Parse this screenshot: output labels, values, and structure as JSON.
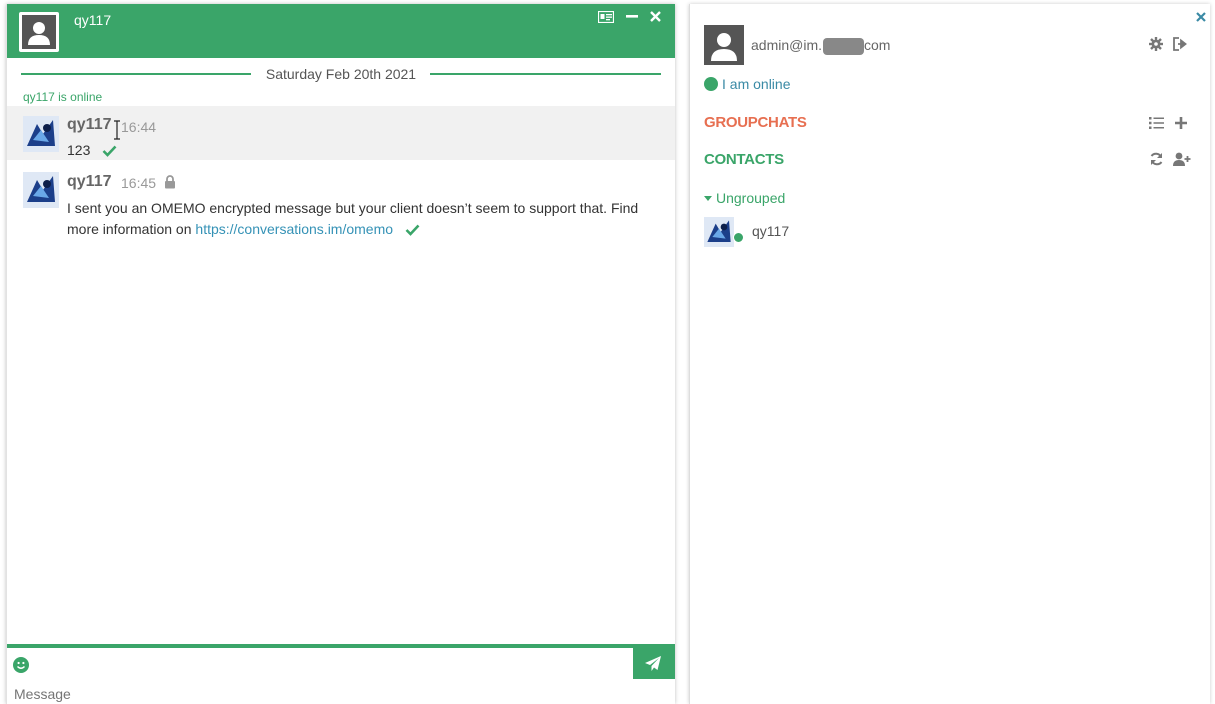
{
  "chat": {
    "title": "qy117",
    "date_separator": "Saturday Feb 20th 2021",
    "status": "qy117 is online",
    "messages": [
      {
        "sender": "qy117",
        "time": "16:44",
        "text": "123"
      },
      {
        "sender": "qy117",
        "time": "16:45",
        "text_before_link": "I sent you an OMEMO encrypted message but your client doesn’t seem to support that. Find more information on ",
        "link": "https://conversations.im/omemo"
      }
    ],
    "input_placeholder": "Message"
  },
  "controlbox": {
    "user_prefix": "admin@im.",
    "user_suffix": "com",
    "status": "I am online",
    "groupchats_heading": "GROUPCHATS",
    "contacts_heading": "CONTACTS",
    "group_name": "Ungrouped",
    "contacts": [
      {
        "name": "qy117"
      }
    ]
  },
  "colors": {
    "accent": "#3aa569",
    "groupchats": "#e76f51",
    "link": "#3592b6"
  }
}
